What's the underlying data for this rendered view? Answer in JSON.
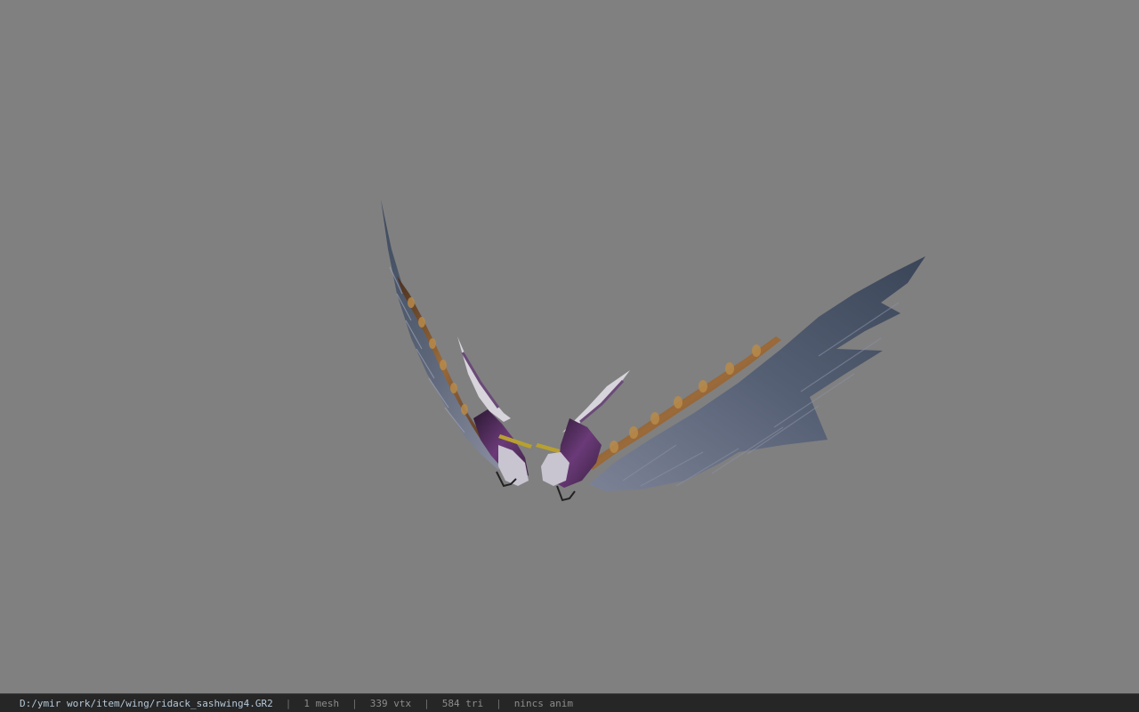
{
  "viewport": {
    "background_color": "#808080",
    "model": "wings"
  },
  "status_bar": {
    "file_path": "D:/ymir work/item/wing/ridack_sashwing4.GR2",
    "separator": "|",
    "mesh_count": "1 mesh",
    "vertex_count": "339 vtx",
    "triangle_count": "584 tri",
    "animation": "nincs anim"
  }
}
